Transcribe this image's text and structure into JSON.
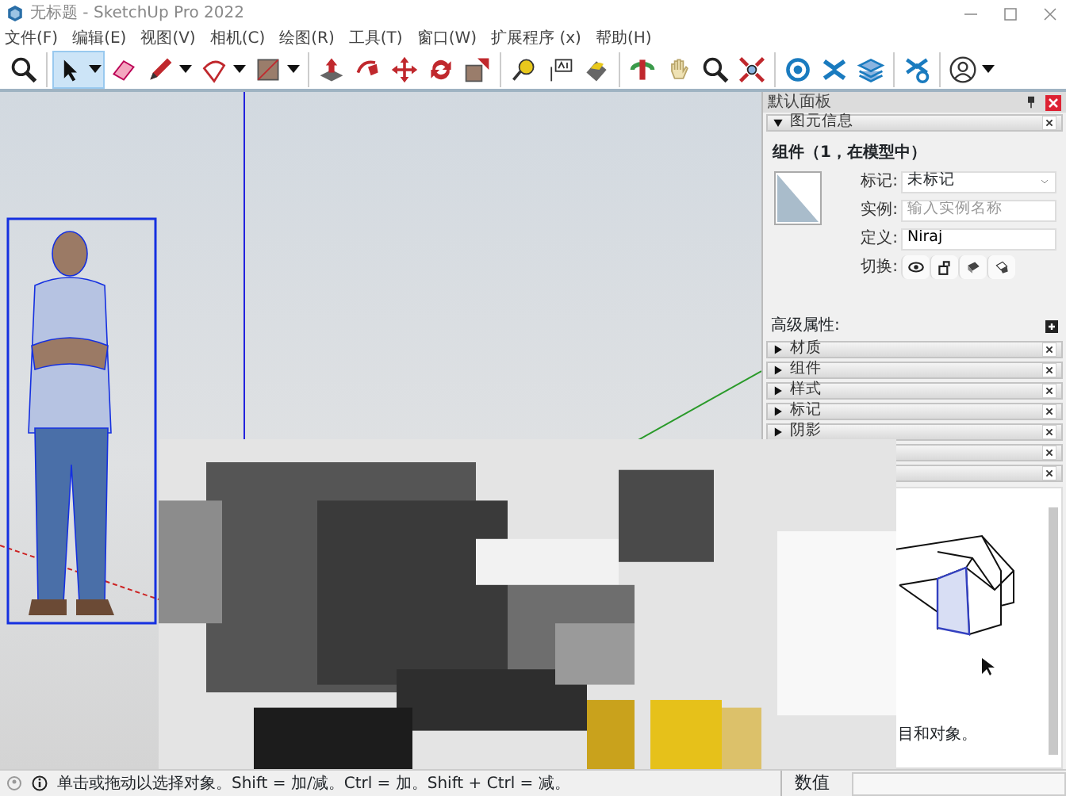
{
  "window": {
    "title": "无标题 - SketchUp Pro 2022"
  },
  "menu": [
    "文件(F)",
    "编辑(E)",
    "视图(V)",
    "相机(C)",
    "绘图(R)",
    "工具(T)",
    "窗口(W)",
    "扩展程序 (x)",
    "帮助(H)"
  ],
  "toolbar": [
    {
      "kind": "zoom",
      "selected": false,
      "dropdown": false
    },
    {
      "kind": "separator"
    },
    {
      "kind": "select",
      "selected": true,
      "dropdown": true
    },
    {
      "kind": "eraser",
      "selected": false,
      "dropdown": false
    },
    {
      "kind": "pencil",
      "selected": false,
      "dropdown": true
    },
    {
      "kind": "arc",
      "selected": false,
      "dropdown": true
    },
    {
      "kind": "rectangle",
      "selected": false,
      "dropdown": true
    },
    {
      "kind": "separator"
    },
    {
      "kind": "push-pull",
      "selected": false,
      "dropdown": false
    },
    {
      "kind": "follow-me",
      "selected": false,
      "dropdown": false
    },
    {
      "kind": "move",
      "selected": false,
      "dropdown": false
    },
    {
      "kind": "rotate",
      "selected": false,
      "dropdown": false
    },
    {
      "kind": "scale",
      "selected": false,
      "dropdown": false
    },
    {
      "kind": "separator"
    },
    {
      "kind": "tape",
      "selected": false,
      "dropdown": false
    },
    {
      "kind": "text",
      "selected": false,
      "dropdown": false
    },
    {
      "kind": "paint",
      "selected": false,
      "dropdown": false
    },
    {
      "kind": "separator"
    },
    {
      "kind": "orbit",
      "selected": false,
      "dropdown": false
    },
    {
      "kind": "pan",
      "selected": false,
      "dropdown": false
    },
    {
      "kind": "zoom",
      "selected": false,
      "dropdown": false
    },
    {
      "kind": "zoom-extents",
      "selected": false,
      "dropdown": false
    },
    {
      "kind": "separator"
    },
    {
      "kind": "warehouse",
      "selected": false,
      "dropdown": false
    },
    {
      "kind": "extension",
      "selected": false,
      "dropdown": false
    },
    {
      "kind": "layers",
      "selected": false,
      "dropdown": false
    },
    {
      "kind": "separator"
    },
    {
      "kind": "extension-settings",
      "selected": false,
      "dropdown": false
    },
    {
      "kind": "separator"
    },
    {
      "kind": "account",
      "selected": false,
      "dropdown": true
    }
  ],
  "panel": {
    "title": "默认面板",
    "entity_info": {
      "title": "图元信息",
      "expanded": true,
      "heading": "组件（1，在模型中）",
      "tag_label": "标记:",
      "tag_value": "未标记",
      "instance_label": "实例:",
      "instance_placeholder": "输入实例名称",
      "definition_label": "定义:",
      "definition_value": "Niraj",
      "toggles_label": "切换:",
      "toggles": [
        {
          "kind": "visibility"
        },
        {
          "kind": "lock"
        },
        {
          "kind": "receive-shadows"
        },
        {
          "kind": "cast-shadows"
        }
      ],
      "advanced_label": "高级属性:"
    },
    "trays": [
      {
        "label": "材质",
        "expanded": false
      },
      {
        "label": "组件",
        "expanded": false
      },
      {
        "label": "样式",
        "expanded": false
      },
      {
        "label": "标记",
        "expanded": false
      },
      {
        "label": "阴影",
        "expanded": false
      },
      {
        "closable": true
      },
      {
        "closable": true
      }
    ],
    "help": {
      "text": "目和对象。"
    }
  },
  "status_bar": {
    "hint": "单击或拖动以选择对象。Shift = 加/减。Ctrl = 加。Shift + Ctrl = 减。",
    "measurements_label": "数值"
  }
}
